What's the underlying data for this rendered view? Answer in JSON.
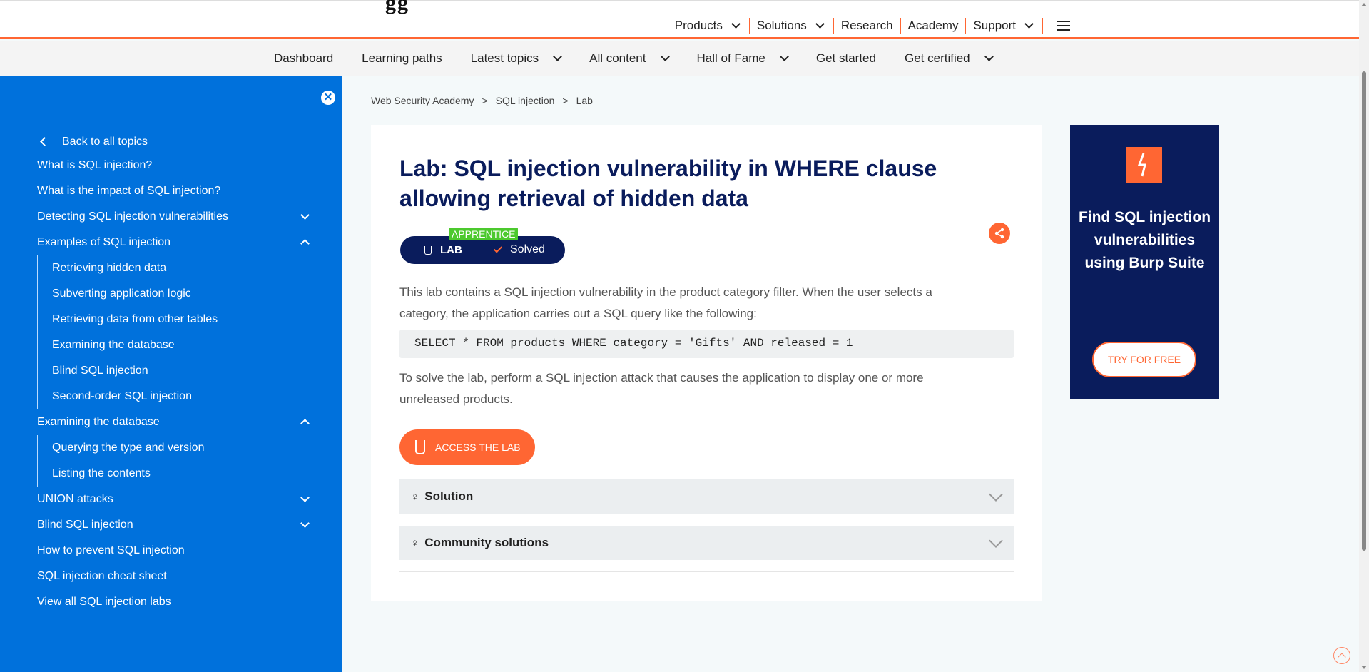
{
  "header": {
    "nav": [
      {
        "label": "Products",
        "dropdown": true
      },
      {
        "label": "Solutions",
        "dropdown": true
      },
      {
        "label": "Research",
        "dropdown": false
      },
      {
        "label": "Academy",
        "dropdown": false
      },
      {
        "label": "Support",
        "dropdown": true
      }
    ]
  },
  "subnav": {
    "items": [
      {
        "label": "Dashboard",
        "dropdown": false
      },
      {
        "label": "Learning paths",
        "dropdown": false
      },
      {
        "label": "Latest topics",
        "dropdown": true
      },
      {
        "label": "All content",
        "dropdown": true
      },
      {
        "label": "Hall of Fame",
        "dropdown": true
      },
      {
        "label": "Get started",
        "dropdown": false
      },
      {
        "label": "Get certified",
        "dropdown": true
      }
    ]
  },
  "sidebar": {
    "close": "✕",
    "back": "Back to all topics",
    "items": [
      {
        "label": "What is SQL injection?"
      },
      {
        "label": "What is the impact of SQL injection?"
      },
      {
        "label": "Detecting SQL injection vulnerabilities",
        "state": "collapsed"
      },
      {
        "label": "Examples of SQL injection",
        "state": "expanded"
      },
      {
        "label": "Retrieving hidden data"
      },
      {
        "label": "Subverting application logic"
      },
      {
        "label": "Retrieving data from other tables"
      },
      {
        "label": "Examining the database"
      },
      {
        "label": "Blind SQL injection"
      },
      {
        "label": "Second-order SQL injection"
      },
      {
        "label": "Examining the database",
        "state": "expanded"
      },
      {
        "label": "Querying the type and version"
      },
      {
        "label": "Listing the contents"
      },
      {
        "label": "UNION attacks",
        "state": "collapsed"
      },
      {
        "label": "Blind SQL injection",
        "state": "collapsed"
      },
      {
        "label": "How to prevent SQL injection"
      },
      {
        "label": "SQL injection cheat sheet"
      },
      {
        "label": "View all SQL injection labs"
      }
    ]
  },
  "breadcrumb": [
    "Web Security Academy",
    ">",
    "SQL injection",
    ">",
    "Lab"
  ],
  "lab": {
    "title": "Lab: SQL injection vulnerability in WHERE clause allowing retrieval of hidden data",
    "level": "APPRENTICE",
    "type": "LAB",
    "status": "Solved",
    "description": "This lab contains a SQL injection vulnerability in the product category filter. When the user selects a category, the application carries out a SQL query like the following:",
    "code": "SELECT * FROM products WHERE category = 'Gifts' AND released = 1",
    "task": "To solve the lab, perform a SQL injection attack that causes the application to display one or more unreleased products.",
    "access_button": "ACCESS THE LAB",
    "accordions": [
      {
        "label": "Solution",
        "icon": "lightbulb-icon"
      },
      {
        "label": "Community solutions",
        "icon": "community-icon"
      }
    ]
  },
  "ad": {
    "title": "Find SQL injection vulnerabilities using Burp Suite",
    "button": "TRY FOR FREE",
    "brand_color": "#ff6633"
  },
  "colors": {
    "accent": "#ff6633",
    "sidebar": "#0071dc",
    "navy": "#0a1c5c",
    "badge_green": "#4cc92e"
  }
}
